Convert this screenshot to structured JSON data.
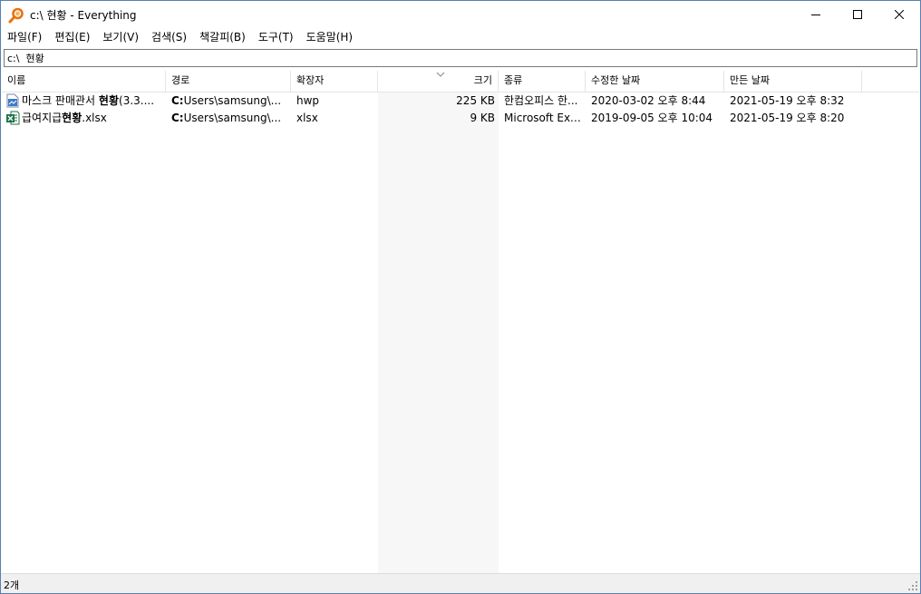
{
  "window": {
    "title": "c:\\  현황 - Everything"
  },
  "menu": [
    "파일(F)",
    "편집(E)",
    "보기(V)",
    "검색(S)",
    "책갈피(B)",
    "도구(T)",
    "도움말(H)"
  ],
  "search": {
    "value": "c:\\  현황"
  },
  "columns": {
    "name": "이름",
    "path": "경로",
    "ext": "확장자",
    "size": "크기",
    "type": "종류",
    "modified": "수정한 날짜",
    "created": "만든 날짜"
  },
  "rows": [
    {
      "name_prefix": "마스크 판매관서 ",
      "name_match": "현황",
      "name_suffix": "(3.3....",
      "path_prefix": "C:",
      "path_rest": "Users\\samsung\\...",
      "ext": "hwp",
      "size": "225 KB",
      "type": "한컴오피스 한...",
      "modified": "2020-03-02 오후 8:44",
      "created": "2021-05-19 오후 8:32",
      "icon": "hwp-file-icon"
    },
    {
      "name_prefix": "급여지급",
      "name_match": "현황",
      "name_suffix": ".xlsx",
      "path_prefix": "C:",
      "path_rest": "Users\\samsung\\...",
      "ext": "xlsx",
      "size": "9 KB",
      "type": "Microsoft Exce...",
      "modified": "2019-09-05 오후 10:04",
      "created": "2021-05-19 오후 8:20",
      "icon": "excel-file-icon"
    }
  ],
  "status": {
    "count": "2개"
  },
  "colors": {
    "accent": "#e8730e",
    "sorted_column_bg": "#f7f7f7",
    "excel_green": "#1e7145",
    "hwp_blue": "#3b7bc8"
  }
}
